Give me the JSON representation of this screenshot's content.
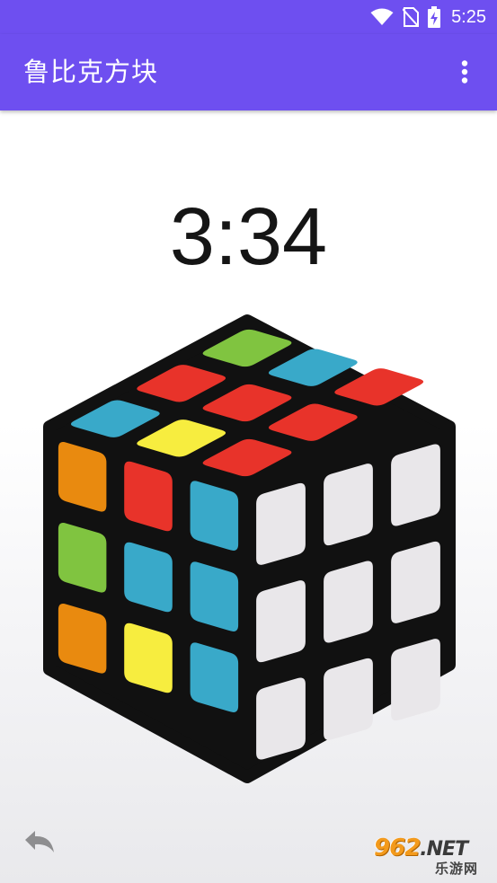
{
  "status_bar": {
    "time": "5:25",
    "icons": [
      "wifi-icon",
      "no-sim-icon",
      "battery-charging-icon"
    ]
  },
  "app_bar": {
    "title": "鲁比克方块",
    "menu_icon": "more-vert-icon"
  },
  "timer": {
    "value": "3:34"
  },
  "cube": {
    "colors": {
      "red": "#e8332a",
      "orange": "#e98a0f",
      "yellow": "#f7ed3f",
      "green": "#80c440",
      "blue": "#39a9c9",
      "white": "#e9e7ea",
      "body": "#111111"
    },
    "faces": {
      "top": [
        [
          "blue",
          "red",
          "green"
        ],
        [
          "yellow",
          "red",
          "blue"
        ],
        [
          "red",
          "red",
          "red"
        ]
      ],
      "left": [
        [
          "orange",
          "red",
          "blue"
        ],
        [
          "green",
          "blue",
          "blue"
        ],
        [
          "orange",
          "yellow",
          "blue"
        ]
      ],
      "right": [
        [
          "white",
          "white",
          "white"
        ],
        [
          "white",
          "white",
          "white"
        ],
        [
          "white",
          "white",
          "white"
        ]
      ]
    }
  },
  "controls": {
    "undo_icon": "undo-icon"
  },
  "watermark": {
    "main": "962",
    "suffix": ".NET",
    "sub": "乐游网"
  }
}
